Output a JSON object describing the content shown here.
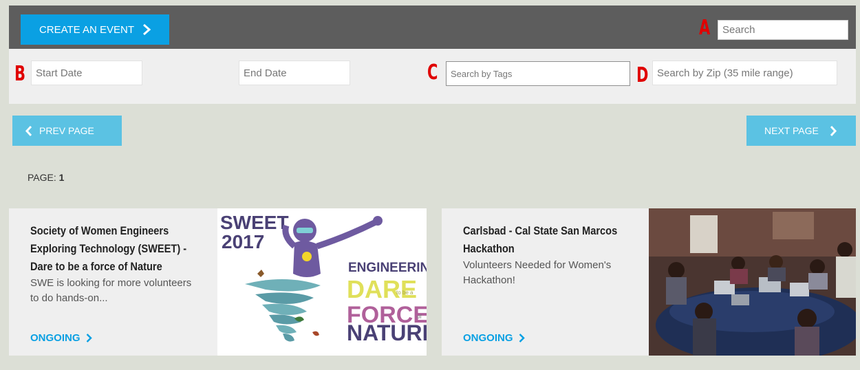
{
  "topbar": {
    "create_label": "CREATE AN EVENT",
    "search_placeholder": "Search",
    "marker_a": "A"
  },
  "filters": {
    "marker_b": "B",
    "marker_c": "C",
    "marker_d": "D",
    "start_placeholder": "Start Date",
    "end_placeholder": "End Date",
    "tags_placeholder": "Search by Tags",
    "zip_placeholder": "Search by Zip (35 mile range)"
  },
  "pagination": {
    "prev_label": "PREV PAGE",
    "next_label": "NEXT PAGE",
    "page_prefix": "PAGE:",
    "page_number": "1"
  },
  "events": [
    {
      "title": "Society of Women Engineers Exploring Technology (SWEET) - Dare to be a force of Nature",
      "description": "SWE is looking for more volunteers to do hands-on...",
      "status": "ONGOING",
      "image_text": [
        "SWEET",
        "2017",
        "ENGINEERING:",
        "DARE",
        "to be a",
        "FORCE",
        "of",
        "NATURE"
      ]
    },
    {
      "title": "Carlsbad - Cal State San Marcos Hackathon",
      "description": "Volunteers Needed for Women's Hackathon!",
      "status": "ONGOING"
    }
  ],
  "colors": {
    "accent": "#0aa0e3",
    "page_button": "#5bc2e3",
    "topbar": "#5d5d5d",
    "marker": "#e00000"
  }
}
